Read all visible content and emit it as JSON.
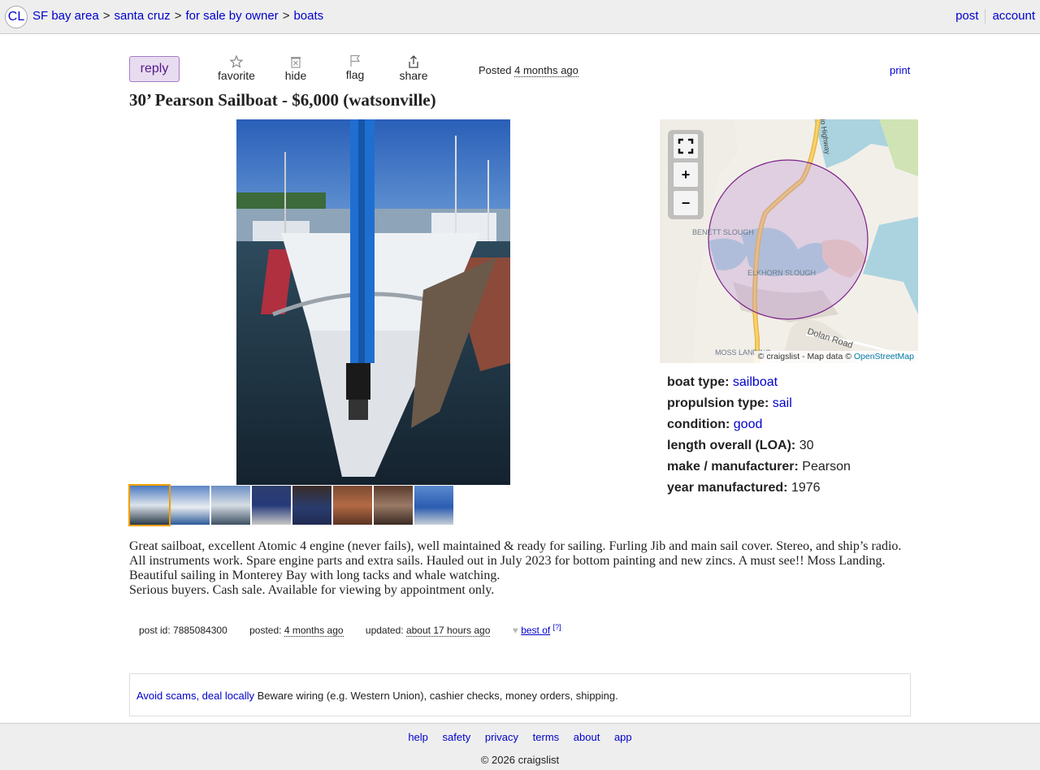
{
  "header": {
    "logo": "CL",
    "breadcrumbs": [
      "SF bay area",
      "santa cruz",
      "for sale by owner",
      "boats"
    ],
    "breadcrumb_sep": ">",
    "post_link": "post",
    "account_link": "account"
  },
  "actions": {
    "reply": "reply",
    "favorite": "favorite",
    "hide": "hide",
    "flag": "flag",
    "share": "share",
    "posted_prefix": "Posted",
    "posted_when": "4 months ago",
    "print": "print"
  },
  "title": "30’ Pearson Sailboat - $6,000 (watsonville)",
  "gallery": {
    "thumbnail_count": 8,
    "selected_index": 0
  },
  "map": {
    "labels": [
      "BENETT SLOUGH",
      "ELKHORN SLOUGH",
      "Dolan Road",
      "MOSS LANDING",
      "lllo Highway"
    ],
    "attribution": "© craigslist - Map data ©",
    "attribution_link": "OpenStreetMap",
    "controls": {
      "fullscreen_icon": "fullscreen-icon",
      "zoom_in": "+",
      "zoom_out": "−"
    }
  },
  "attributes": [
    {
      "label": "boat type:",
      "value": "sailboat",
      "link": true
    },
    {
      "label": "propulsion type:",
      "value": "sail",
      "link": true
    },
    {
      "label": "condition:",
      "value": "good",
      "link": true
    },
    {
      "label": "length overall (LOA):",
      "value": "30",
      "link": false
    },
    {
      "label": "make / manufacturer:",
      "value": "Pearson",
      "link": false
    },
    {
      "label": "year manufactured:",
      "value": "1976",
      "link": false
    }
  ],
  "description": [
    "Great sailboat, excellent Atomic 4 engine (never fails), well maintained & ready for sailing. Furling Jib and main sail cover. Stereo, and ship’s radio. All instruments work. Spare engine parts and extra sails. Hauled out in July 2023 for bottom painting and new zincs. A must see!! Moss Landing. Beautiful sailing in Monterey Bay with long tacks and whale watching.",
    "Serious buyers. Cash sale. Available for viewing by appointment only."
  ],
  "meta": {
    "post_id_label": "post id: 7885084300",
    "posted_label": "posted:",
    "posted_value": "4 months ago",
    "updated_label": "updated:",
    "updated_value": "about 17 hours ago",
    "best_of": "best of",
    "best_of_help": "[?]"
  },
  "scam_notice": {
    "link": "Avoid scams, deal locally",
    "text": "Beware wiring (e.g. Western Union), cashier checks, money orders, shipping."
  },
  "footer": {
    "links": [
      "help",
      "safety",
      "privacy",
      "terms",
      "about",
      "app"
    ],
    "copyright": "© 2026 craigslist"
  },
  "colors": {
    "link": "#0000cc",
    "reply_bg": "#e8dcf0",
    "reply_border": "#a87cc9",
    "thumb_selected": "#f0a000"
  }
}
